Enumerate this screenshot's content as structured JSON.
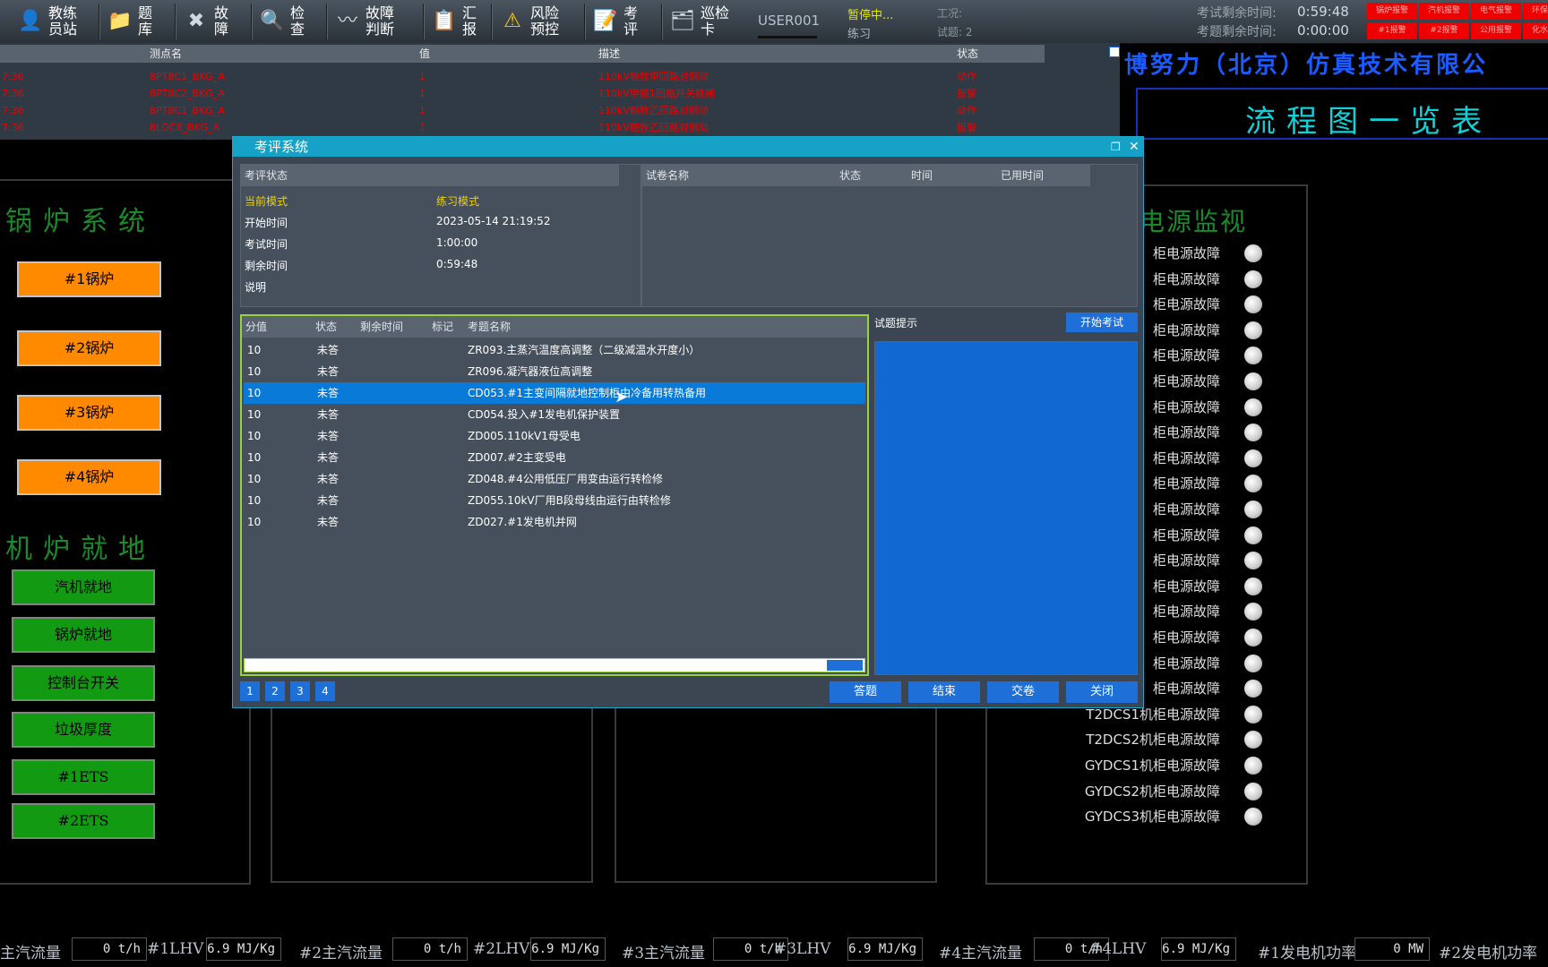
{
  "toolbar": {
    "buttons": [
      {
        "label": "教练\n员站",
        "icon": "trainer-icon"
      },
      {
        "label": "题\n库",
        "icon": "folder-icon"
      },
      {
        "label": "故\n障",
        "icon": "fault-icon"
      },
      {
        "label": "检\n查",
        "icon": "magnifier-icon"
      },
      {
        "label": "故障\n判断",
        "icon": "waveform-icon"
      },
      {
        "label": "汇\n报",
        "icon": "clipboard-icon"
      },
      {
        "label": "风险\n预控",
        "icon": "warning-icon"
      },
      {
        "label": "考\n评",
        "icon": "exam-icon"
      },
      {
        "label": "巡检\n卡",
        "icon": "inspection-card-icon"
      }
    ],
    "user": "USER001",
    "status_paused": "暂停中...",
    "status_mode": "练习",
    "work_label": "工况:",
    "question_label": "试题: 2",
    "exam_remaining_label": "考试剩余时间:",
    "exam_remaining_value": "0:59:48",
    "question_remaining_label": "考题剩余时间:",
    "question_remaining_value": "0:00:00",
    "alarm_cells": [
      "锅炉报警",
      "汽机报警",
      "电气报警",
      "环保报警",
      "#1报警",
      "#2报警",
      "公用报警",
      "化水报警",
      "",
      "",
      ""
    ]
  },
  "alarm_list": {
    "headers": {
      "point": "测点名",
      "value": "值",
      "desc": "描述",
      "status": "状态"
    },
    "rows": [
      {
        "time": "7:36",
        "point": "8PT8C1_BKG_A",
        "value": "1",
        "desc": "110kV鲍牧甲回路对侧动",
        "status": "动作"
      },
      {
        "time": "7:36",
        "point": "8PT8C2_BKG_A",
        "value": "1",
        "desc": "110kV甲鲍1回路开关跳闸",
        "status": "报警"
      },
      {
        "time": "7:36",
        "point": "8PT8C1_BKG_A",
        "value": "1",
        "desc": "110kV鲍牧乙回路对侧动",
        "status": "动作"
      },
      {
        "time": "7:36",
        "point": "8LGC8_BKG_A",
        "value": "1",
        "desc": "110kV鲍牧乙回路对侧动",
        "status": "报警"
      }
    ]
  },
  "company": "博努力（北京）仿真技术有限公",
  "flow_title": "流程图一览表",
  "left": {
    "boiler_title": "锅炉系统",
    "boilers": [
      "#1锅炉",
      "#2锅炉",
      "#3锅炉",
      "#4锅炉"
    ],
    "local_title": "机炉就地",
    "local_buttons": [
      "汽机就地",
      "锅炉就地",
      "控制台开关",
      "垃圾厚度",
      "#1ETS",
      "#2ETS"
    ]
  },
  "power_monitor": {
    "title": "电源监视",
    "rows": [
      "柜电源故障",
      "柜电源故障",
      "柜电源故障",
      "柜电源故障",
      "柜电源故障",
      "柜电源故障",
      "柜电源故障",
      "柜电源故障",
      "柜电源故障",
      "柜电源故障",
      "柜电源故障",
      "柜电源故障",
      "柜电源故障",
      "柜电源故障",
      "柜电源故障",
      "柜电源故障",
      "柜电源故障",
      "柜电源故障",
      "T2DCS1机柜电源故障",
      "T2DCS2机柜电源故障",
      "GYDCS1机柜电源故障",
      "GYDCS2机柜电源故障",
      "GYDCS3机柜电源故障"
    ]
  },
  "bottom": [
    {
      "label": "主汽流量",
      "value": "0 t/h"
    },
    {
      "label": "#1LHV",
      "value": "6.9 MJ/Kg"
    },
    {
      "label": "#2主汽流量",
      "value": "0 t/h"
    },
    {
      "label": "#2LHV",
      "value": "6.9 MJ/Kg"
    },
    {
      "label": "#3主汽流量",
      "value": "0 t/h"
    },
    {
      "label": "#3LHV",
      "value": "6.9 MJ/Kg"
    },
    {
      "label": "#4主汽流量",
      "value": "0 t/h"
    },
    {
      "label": "#4LHV",
      "value": "6.9 MJ/Kg"
    },
    {
      "label": "#1发电机功率",
      "value": "0 MW"
    },
    {
      "label": "#2发电机功率",
      "value": ""
    }
  ],
  "dialog": {
    "title": "考评系统",
    "status": {
      "header": "考评状态",
      "mode_label": "当前模式",
      "mode_value": "练习模式",
      "start_label": "开始时间",
      "start_value": "2023-05-14 21:19:52",
      "duration_label": "考试时间",
      "duration_value": "1:00:00",
      "remaining_label": "剩余时间",
      "remaining_value": "0:59:48",
      "note_label": "说明"
    },
    "paper_headers": {
      "name": "试卷名称",
      "status": "状态",
      "time": "时间",
      "used": "已用时间"
    },
    "question_headers": {
      "score": "分值",
      "status": "状态",
      "remaining": "剩余时间",
      "mark": "标记",
      "name": "考题名称"
    },
    "questions": [
      {
        "score": "10",
        "status": "未答",
        "name": "ZR093.主蒸汽温度高调整（二级减温水开度小）"
      },
      {
        "score": "10",
        "status": "未答",
        "name": "ZR096.凝汽器液位高调整"
      },
      {
        "score": "10",
        "status": "未答",
        "name": "CD053.#1主变间隔就地控制柜由冷备用转热备用"
      },
      {
        "score": "10",
        "status": "未答",
        "name": "CD054.投入#1发电机保护装置"
      },
      {
        "score": "10",
        "status": "未答",
        "name": "ZD005.110kV1母受电"
      },
      {
        "score": "10",
        "status": "未答",
        "name": "ZD007.#2主变受电"
      },
      {
        "score": "10",
        "status": "未答",
        "name": "ZD048.#4公用低压厂用变由运行转检修"
      },
      {
        "score": "10",
        "status": "未答",
        "name": "ZD055.10kV厂用B段母线由运行由转检修"
      },
      {
        "score": "10",
        "status": "未答",
        "name": "ZD027.#1发电机并网"
      }
    ],
    "selected_index": 2,
    "hint_label": "试题提示",
    "start_button": "开始考试",
    "pages": [
      "1",
      "2",
      "3",
      "4"
    ],
    "actions": [
      "答题",
      "结束",
      "交卷",
      "关闭"
    ]
  }
}
